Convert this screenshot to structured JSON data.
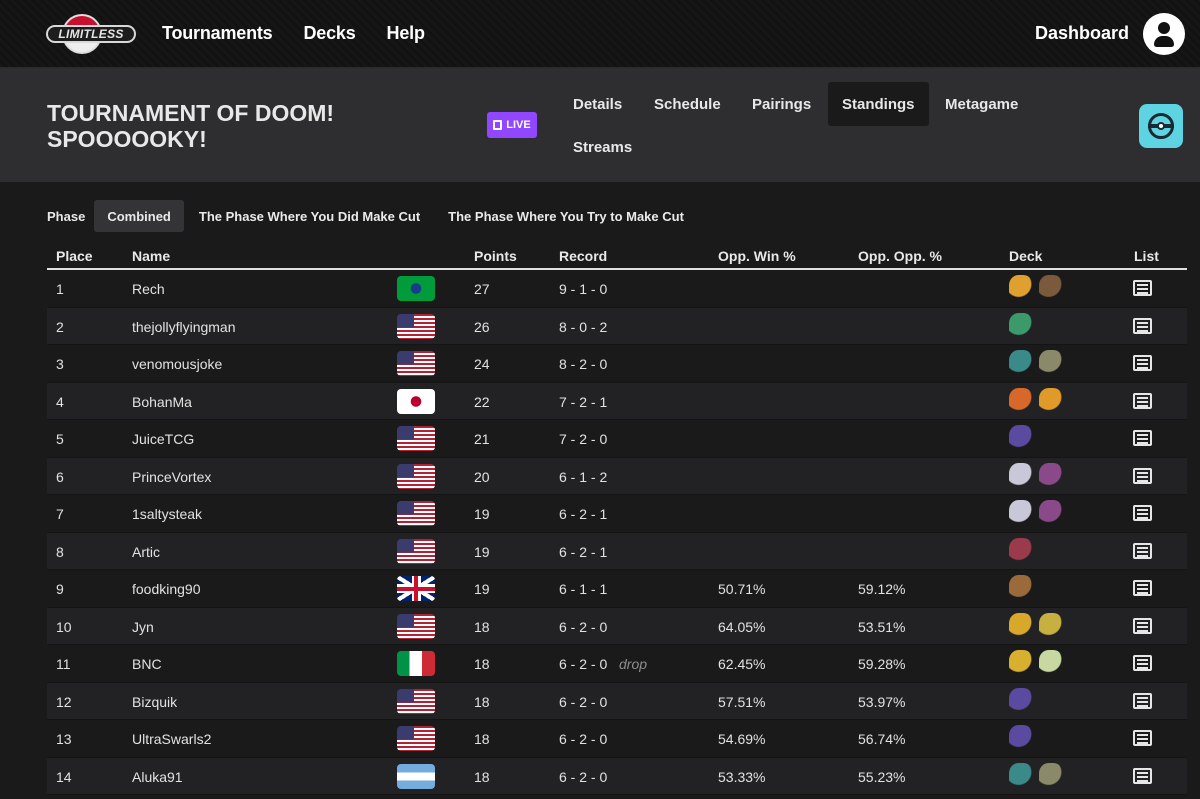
{
  "nav": {
    "logo_text": "Limitless",
    "links": [
      "Tournaments",
      "Decks",
      "Help"
    ],
    "dashboard": "Dashboard"
  },
  "tournament": {
    "title_line1": "TOURNAMENT OF DOOM!",
    "title_line2": "SPOOOOOKY!",
    "live_badge": "LIVE",
    "tabs": [
      "Details",
      "Schedule",
      "Pairings",
      "Standings",
      "Metagame",
      "Streams"
    ],
    "active_tab": "Standings"
  },
  "phase": {
    "label": "Phase",
    "options": [
      "Combined",
      "The Phase Where You Did Make Cut",
      "The Phase Where You Try to Make Cut"
    ],
    "active": "Combined"
  },
  "table": {
    "headers": [
      "Place",
      "Name",
      "Points",
      "Record",
      "Opp. Win %",
      "Opp. Opp. %",
      "Deck",
      "List"
    ],
    "rows": [
      {
        "place": "1",
        "name": "Rech",
        "flag": "brazil",
        "points": "27",
        "record": "9 - 1 - 0",
        "drop": "",
        "opp": "",
        "oppopp": "",
        "deck": [
          "#e0a030",
          "#7a5a3a"
        ]
      },
      {
        "place": "2",
        "name": "thejollyflyingman",
        "flag": "usa",
        "points": "26",
        "record": "8 - 0 - 2",
        "drop": "",
        "opp": "",
        "oppopp": "",
        "deck": [
          "#3c9a6a"
        ]
      },
      {
        "place": "3",
        "name": "venomousjoke",
        "flag": "usa",
        "points": "24",
        "record": "8 - 2 - 0",
        "drop": "",
        "opp": "",
        "oppopp": "",
        "deck": [
          "#3a8a8a",
          "#8a8a6a"
        ]
      },
      {
        "place": "4",
        "name": "BohanMa",
        "flag": "japan",
        "points": "22",
        "record": "7 - 2 - 1",
        "drop": "",
        "opp": "",
        "oppopp": "",
        "deck": [
          "#d8682a",
          "#e09a2a"
        ]
      },
      {
        "place": "5",
        "name": "JuiceTCG",
        "flag": "usa",
        "points": "21",
        "record": "7 - 2 - 0",
        "drop": "",
        "opp": "",
        "oppopp": "",
        "deck": [
          "#5a4aa0"
        ]
      },
      {
        "place": "6",
        "name": "PrinceVortex",
        "flag": "usa",
        "points": "20",
        "record": "6 - 1 - 2",
        "drop": "",
        "opp": "",
        "oppopp": "",
        "deck": [
          "#c8c8d8",
          "#8a4a8a"
        ]
      },
      {
        "place": "7",
        "name": "1saltysteak",
        "flag": "usa",
        "points": "19",
        "record": "6 - 2 - 1",
        "drop": "",
        "opp": "",
        "oppopp": "",
        "deck": [
          "#c8c8d8",
          "#8a4a8a"
        ]
      },
      {
        "place": "8",
        "name": "Artic",
        "flag": "usa",
        "points": "19",
        "record": "6 - 2 - 1",
        "drop": "",
        "opp": "",
        "oppopp": "",
        "deck": [
          "#9a3a4a"
        ]
      },
      {
        "place": "9",
        "name": "foodking90",
        "flag": "uk",
        "points": "19",
        "record": "6 - 1 - 1",
        "drop": "",
        "opp": "50.71%",
        "oppopp": "59.12%",
        "deck": [
          "#9a6a3a"
        ]
      },
      {
        "place": "10",
        "name": "Jyn",
        "flag": "usa",
        "points": "18",
        "record": "6 - 2 - 0",
        "drop": "",
        "opp": "64.05%",
        "oppopp": "53.51%",
        "deck": [
          "#d8a82a",
          "#c8b040"
        ]
      },
      {
        "place": "11",
        "name": "BNC",
        "flag": "italy",
        "points": "18",
        "record": "6 - 2 - 0",
        "drop": "drop",
        "opp": "62.45%",
        "oppopp": "59.28%",
        "deck": [
          "#d8b030",
          "#c8d8a0"
        ]
      },
      {
        "place": "12",
        "name": "Bizquik",
        "flag": "usa",
        "points": "18",
        "record": "6 - 2 - 0",
        "drop": "",
        "opp": "57.51%",
        "oppopp": "53.97%",
        "deck": [
          "#5a4aa0"
        ]
      },
      {
        "place": "13",
        "name": "UltraSwarls2",
        "flag": "usa",
        "points": "18",
        "record": "6 - 2 - 0",
        "drop": "",
        "opp": "54.69%",
        "oppopp": "56.74%",
        "deck": [
          "#5a4aa0"
        ]
      },
      {
        "place": "14",
        "name": "Aluka91",
        "flag": "argentina",
        "points": "18",
        "record": "6 - 2 - 0",
        "drop": "",
        "opp": "53.33%",
        "oppopp": "55.23%",
        "deck": [
          "#3a8a8a",
          "#8a8a6a"
        ]
      }
    ]
  },
  "colors": {
    "twitch": "#9146ff",
    "accent_icon": "#5ed3e2"
  }
}
